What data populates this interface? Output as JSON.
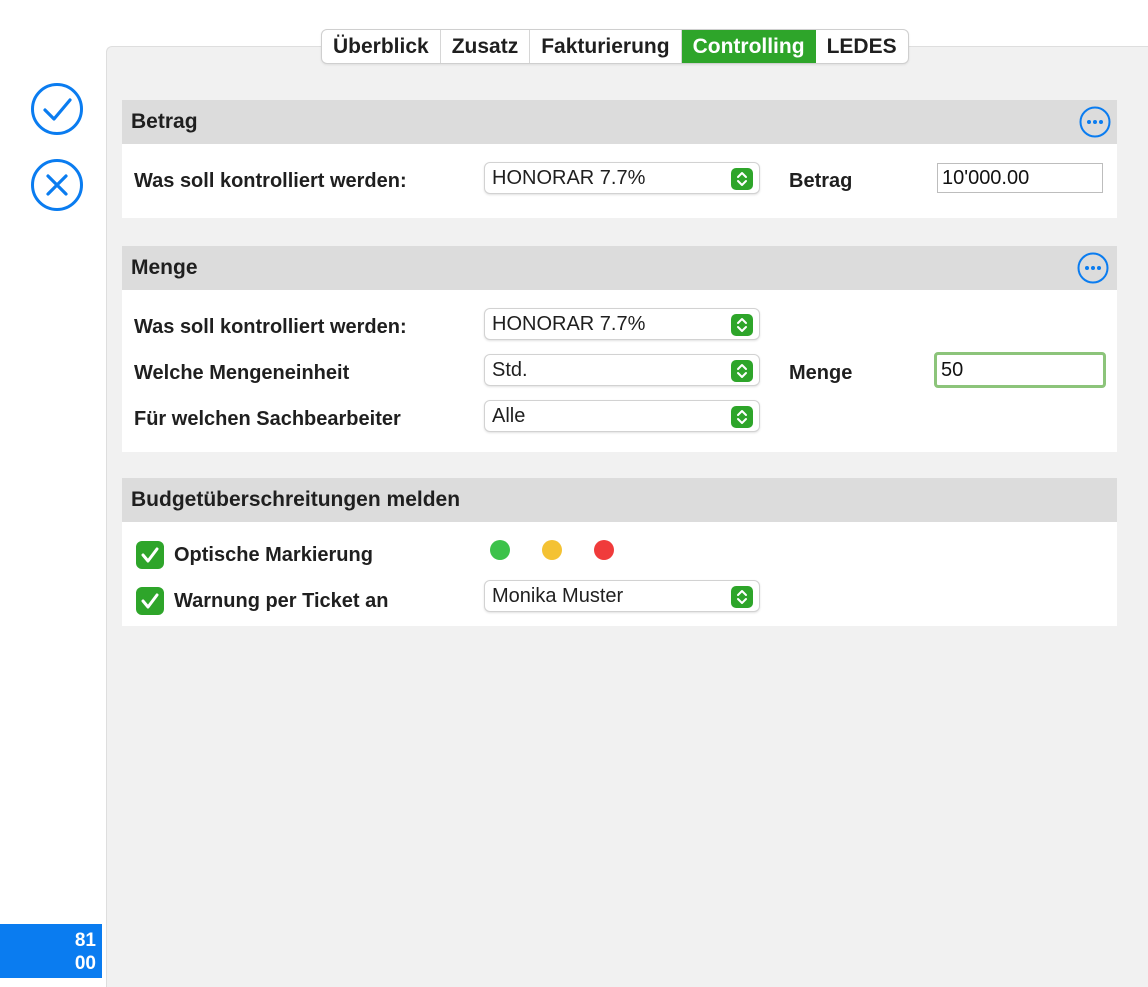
{
  "sidebar": {
    "confirm_icon": "check-circle-icon",
    "cancel_icon": "x-circle-icon",
    "badge_line1": "81",
    "badge_line2": "00"
  },
  "tabs": [
    {
      "label": "Überblick",
      "active": false
    },
    {
      "label": "Zusatz",
      "active": false
    },
    {
      "label": "Fakturierung",
      "active": false
    },
    {
      "label": "Controlling",
      "active": true
    },
    {
      "label": "LEDES",
      "active": false
    }
  ],
  "betrag": {
    "title": "Betrag",
    "what_label": "Was soll kontrolliert werden:",
    "what_value": "HONORAR 7.7%",
    "amount_label": "Betrag",
    "amount_value": "10'000.00"
  },
  "menge": {
    "title": "Menge",
    "what_label": "Was soll kontrolliert werden:",
    "what_value": "HONORAR 7.7%",
    "unit_label": "Welche Mengeneinheit",
    "unit_value": "Std.",
    "person_label": "Für welchen Sachbearbeiter",
    "person_value": "Alle",
    "qty_label": "Menge",
    "qty_value": "50"
  },
  "budget": {
    "title": "Budgetüberschreitungen melden",
    "optical_label": "Optische Markierung",
    "optical_checked": true,
    "ticket_label": "Warnung per Ticket an",
    "ticket_checked": true,
    "ticket_value": "Monika Muster",
    "dot_colors": [
      "#3cc24a",
      "#f4c233",
      "#f03b3b"
    ]
  },
  "colors": {
    "accent_green": "#2ea52a",
    "accent_blue": "#0a7cf0",
    "focus_ring": "#8cc47a"
  }
}
